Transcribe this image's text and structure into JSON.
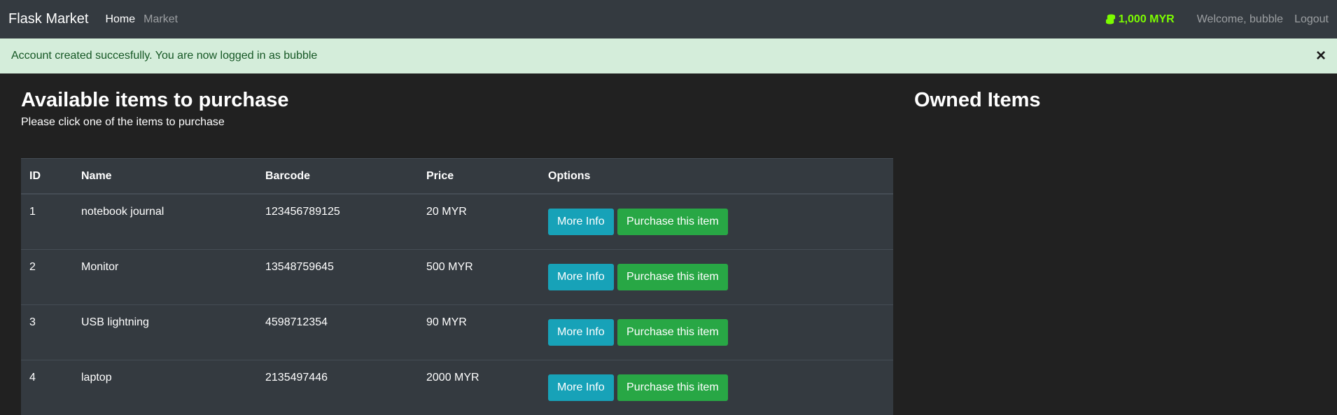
{
  "nav": {
    "brand": "Flask Market",
    "links": [
      {
        "label": "Home"
      },
      {
        "label": "Market"
      }
    ],
    "budget": "1,000 MYR",
    "welcome": "Welcome, bubble",
    "logout": "Logout"
  },
  "alert": {
    "message": "Account created succesfully. You are now logged in as bubble",
    "close": "×"
  },
  "market": {
    "title": "Available items to purchase",
    "subtitle": "Please click one of the items to purchase",
    "columns": [
      "ID",
      "Name",
      "Barcode",
      "Price",
      "Options"
    ],
    "rows": [
      {
        "id": "1",
        "name": "notebook journal",
        "barcode": "123456789125",
        "price": "20 MYR"
      },
      {
        "id": "2",
        "name": "Monitor",
        "barcode": "13548759645",
        "price": "500 MYR"
      },
      {
        "id": "3",
        "name": "USB lightning",
        "barcode": "4598712354",
        "price": "90 MYR"
      },
      {
        "id": "4",
        "name": "laptop",
        "barcode": "2135497446",
        "price": "2000 MYR"
      }
    ],
    "more_info_label": "More Info",
    "purchase_label": "Purchase this item"
  },
  "owned": {
    "title": "Owned Items"
  },
  "colors": {
    "navbar": "#343a40",
    "budget": "#7cfc00",
    "alert_bg": "#d4edda",
    "info": "#17a2b8",
    "success": "#28a745"
  }
}
